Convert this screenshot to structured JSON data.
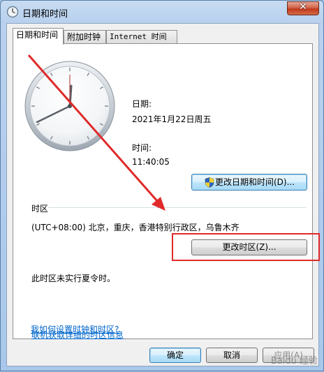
{
  "window": {
    "title": "日期和时间",
    "close_glyph": "✕"
  },
  "tabs": [
    {
      "label": "日期和时间"
    },
    {
      "label": "附加时钟"
    },
    {
      "label": "Internet 时间"
    }
  ],
  "datetime": {
    "date_label": "日期:",
    "date_value": "2021年1月22日周五",
    "time_label": "时间:",
    "time_value": "11:40:05",
    "change_button": "更改日期和时间(D)..."
  },
  "timezone": {
    "section_label": "时区",
    "value": "(UTC+08:00) 北京，重庆，香港特别行政区，乌鲁木齐",
    "change_button": "更改时区(Z)...",
    "dst_note": "此时区未实行夏令时。"
  },
  "links": {
    "online_info": "联机获取详细的时区信息",
    "how_to": "我如何设置时钟和时区?"
  },
  "footer": {
    "ok": "确定",
    "cancel": "取消",
    "apply": "应用(A)"
  },
  "watermark": "Baidu 经验",
  "icons": {
    "title": "clock-icon",
    "uac": "uac-shield-icon",
    "close": "close-icon"
  },
  "colors": {
    "annotation": "#e02a2a",
    "link": "#0066cc"
  }
}
